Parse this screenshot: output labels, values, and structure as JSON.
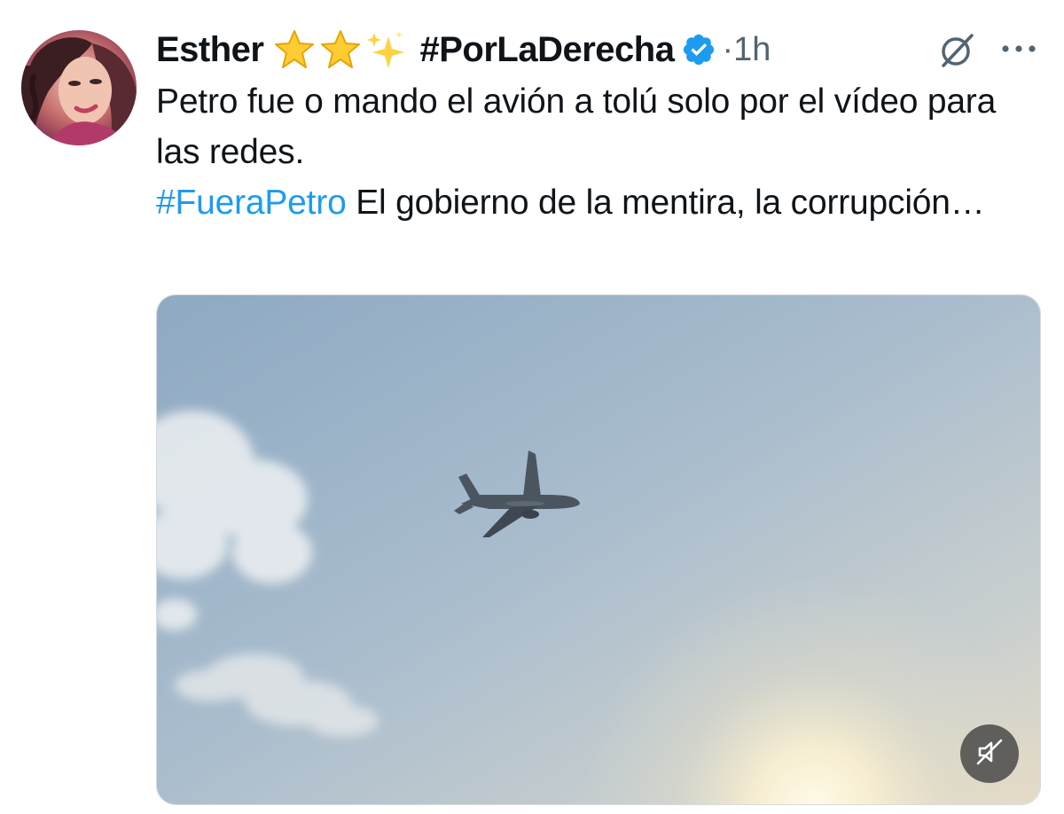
{
  "tweet": {
    "author": {
      "name": "Esther",
      "name_emojis": [
        "star-emoji",
        "star-emoji",
        "sparkles-emoji"
      ],
      "name_hashtag": "#PorLaDerecha",
      "verified": true,
      "verified_color": "#1d9bf0",
      "avatar_icon": "avatar-photo"
    },
    "separator": "·",
    "time": "1h",
    "text": {
      "line1": "Petro fue o mando el avión a tolú solo por el vídeo para las redes.",
      "hashtag": "#FueraPetro",
      "after_hashtag": " El gobierno de la mentira, la corrupción…"
    },
    "hashtag_color": "#1d9bf0",
    "media": {
      "type": "video",
      "description_icon": "airplane-in-sky",
      "mute_icon": "muted-speaker-icon"
    },
    "actions": {
      "grok_icon": "grok-icon",
      "more_icon": "more-dots-icon"
    }
  }
}
